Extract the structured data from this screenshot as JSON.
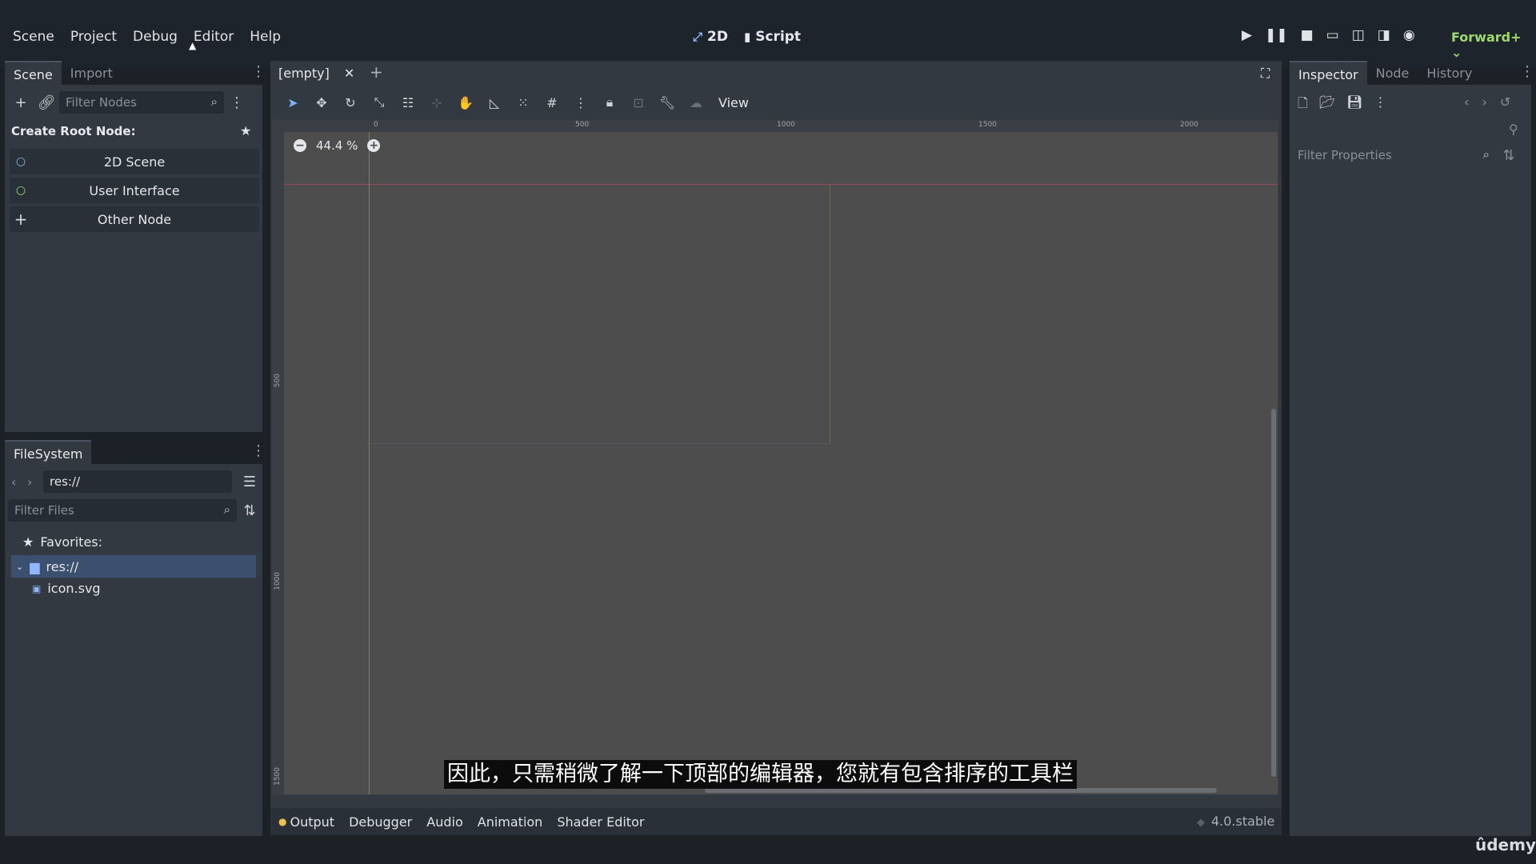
{
  "menu": [
    "Scene",
    "Project",
    "Debug",
    "Editor",
    "Help"
  ],
  "workspace_tabs": [
    {
      "label": "2D",
      "icon": "2d-icon"
    },
    {
      "label": "Script",
      "icon": "script-icon"
    }
  ],
  "renderer": "Forward+",
  "scene_dock": {
    "tabs": [
      "Scene",
      "Import"
    ],
    "filter_placeholder": "Filter Nodes",
    "create_root_label": "Create Root Node:",
    "nodes": [
      {
        "label": "2D Scene",
        "icon": "○",
        "color": "#8fb6ff"
      },
      {
        "label": "User Interface",
        "icon": "○",
        "color": "#8ede6e"
      },
      {
        "label": "Other Node",
        "icon": "+",
        "color": "#dfe3e8"
      }
    ]
  },
  "filesystem": {
    "tab": "FileSystem",
    "path": "res://",
    "filter_placeholder": "Filter Files",
    "favorites_label": "Favorites:",
    "root_label": "res://",
    "files": [
      "icon.svg"
    ]
  },
  "editor": {
    "tab_label": "[empty]",
    "view_menu": "View",
    "zoom": "44.4 %",
    "ruler_marks": [
      "0",
      "500",
      "1000",
      "1500",
      "2000"
    ],
    "ruler_marks_left": [
      "500",
      "1000",
      "1500"
    ]
  },
  "subtitle": "因此，只需稍微了解一下顶部的编辑器，您就有包含排序的工具栏",
  "bottom_panel": {
    "tabs": [
      "Output",
      "Debugger",
      "Audio",
      "Animation",
      "Shader Editor"
    ],
    "version": "4.0.stable"
  },
  "inspector": {
    "tabs": [
      "Inspector",
      "Node",
      "History"
    ],
    "filter_placeholder": "Filter Properties"
  },
  "watermark": "ûdemy"
}
